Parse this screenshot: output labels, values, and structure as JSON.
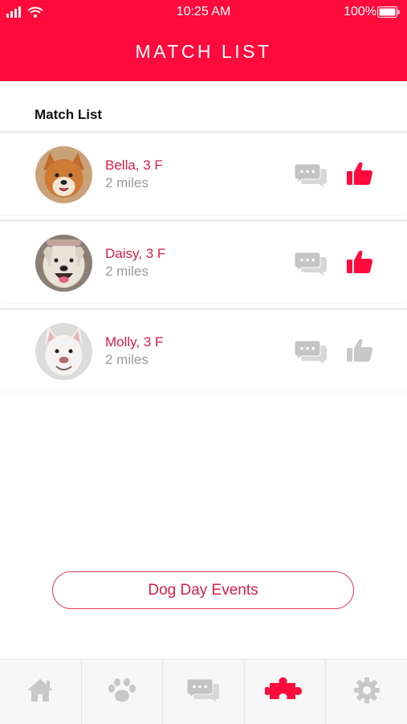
{
  "status_bar": {
    "time": "10:25 AM",
    "battery": "100%"
  },
  "header": {
    "title": "MATCH LIST"
  },
  "section": {
    "label": "Match List"
  },
  "matches": [
    {
      "name": "Bella, 3 F",
      "distance": "2 miles",
      "liked": true
    },
    {
      "name": "Daisy, 3 F",
      "distance": "2 miles",
      "liked": true
    },
    {
      "name": "Molly, 3 F",
      "distance": "2 miles",
      "liked": false
    }
  ],
  "cta": {
    "label": "Dog Day Events"
  },
  "tabs": [
    {
      "icon": "home-icon",
      "active": false
    },
    {
      "icon": "paw-icon",
      "active": false
    },
    {
      "icon": "chat-icon",
      "active": false
    },
    {
      "icon": "puzzle-icon",
      "active": true
    },
    {
      "icon": "gear-icon",
      "active": false
    }
  ],
  "colors": {
    "accent": "#ff0a3c",
    "text_accent": "#d61e46",
    "muted": "#9a9a9a",
    "icon_inactive": "#c8c8c8"
  }
}
